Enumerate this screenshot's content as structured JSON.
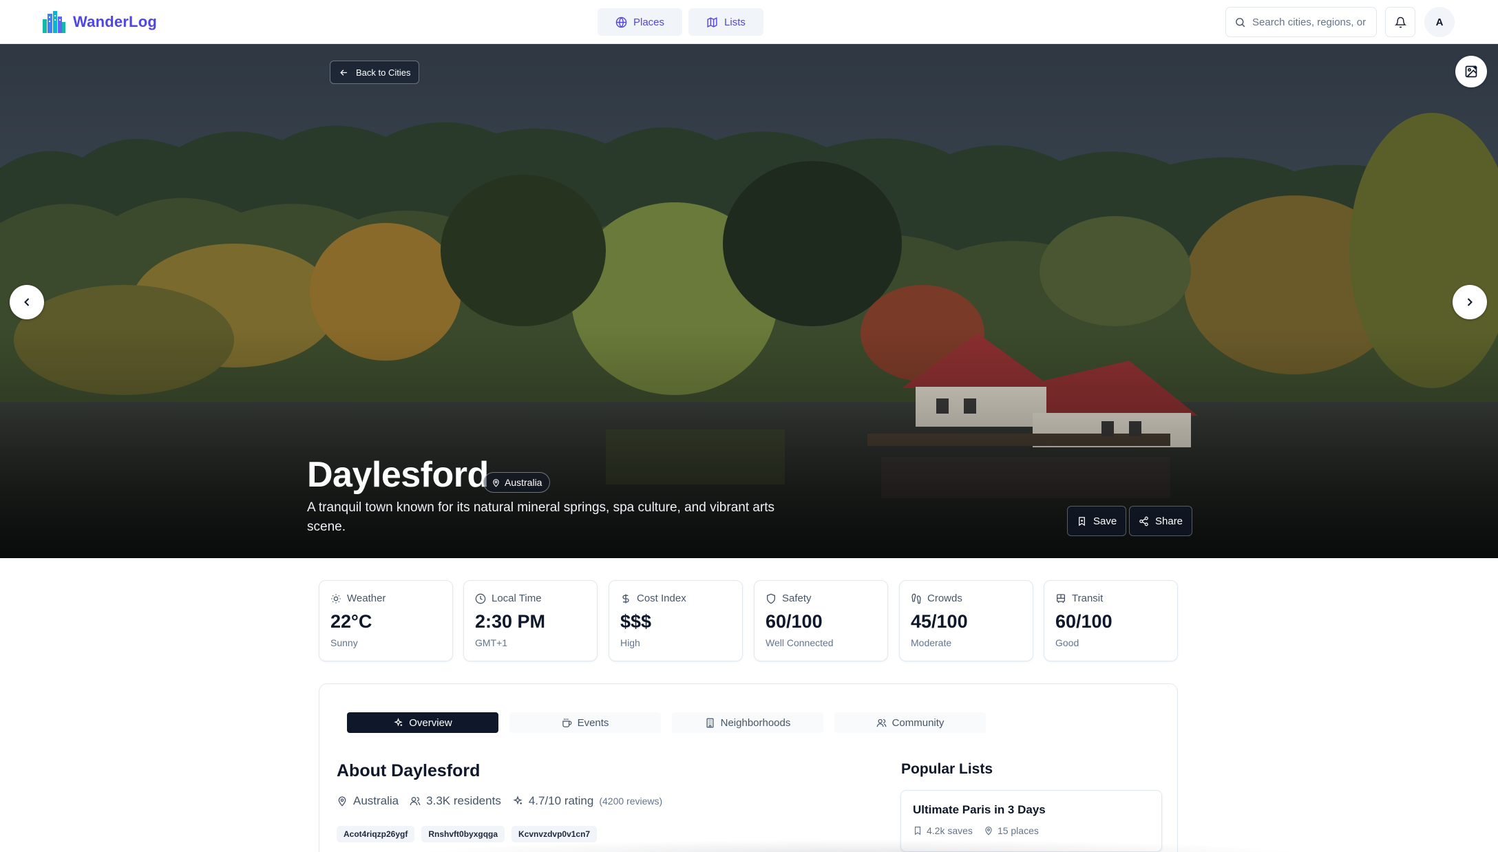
{
  "header": {
    "brand": "WanderLog",
    "nav": [
      {
        "label": "Places",
        "icon": "globe-icon"
      },
      {
        "label": "Lists",
        "icon": "map-icon"
      }
    ],
    "search_placeholder": "Search cities, regions, or",
    "notification_icon": "bell-icon",
    "avatar_initial": "A"
  },
  "hero": {
    "back_label": "Back to Cities",
    "title": "Daylesford",
    "country": "Australia",
    "description": "A tranquil town known for its natural mineral springs, spa culture, and vibrant arts scene.",
    "save_label": "Save",
    "share_label": "Share"
  },
  "stats": [
    {
      "label": "Weather",
      "value": "22°C",
      "sub": "Sunny",
      "icon": "sun-icon"
    },
    {
      "label": "Local Time",
      "value": "2:30 PM",
      "sub": "GMT+1",
      "icon": "clock-icon"
    },
    {
      "label": "Cost Index",
      "value": "$$$",
      "sub": "High",
      "icon": "dollar-icon"
    },
    {
      "label": "Safety",
      "value": "60/100",
      "sub": "Well Connected",
      "icon": "shield-icon"
    },
    {
      "label": "Crowds",
      "value": "45/100",
      "sub": "Moderate",
      "icon": "footprints-icon"
    },
    {
      "label": "Transit",
      "value": "60/100",
      "sub": "Good",
      "icon": "bus-icon"
    }
  ],
  "tabs": [
    {
      "label": "Overview",
      "active": true,
      "icon": "sparkles-icon"
    },
    {
      "label": "Events",
      "active": false,
      "icon": "coffee-icon"
    },
    {
      "label": "Neighborhoods",
      "active": false,
      "icon": "building-icon"
    },
    {
      "label": "Community",
      "active": false,
      "icon": "users-icon"
    }
  ],
  "about": {
    "title": "About Daylesford",
    "country": "Australia",
    "residents": "3.3K residents",
    "rating": "4.7/10 rating",
    "reviews": "(4200 reviews)",
    "tags": [
      "Acot4riqzp26ygf",
      "Rnshvft0byxgqga",
      "Kcvnvzdvp0v1cn7"
    ]
  },
  "popular": {
    "title": "Popular Lists",
    "lists": [
      {
        "title": "Ultimate Paris in 3 Days",
        "saves": "4.2k saves",
        "places": "15 places"
      }
    ]
  },
  "colors": {
    "brand": "#4f46e5",
    "active_tab": "#0f172a",
    "text_muted": "#64748b"
  }
}
